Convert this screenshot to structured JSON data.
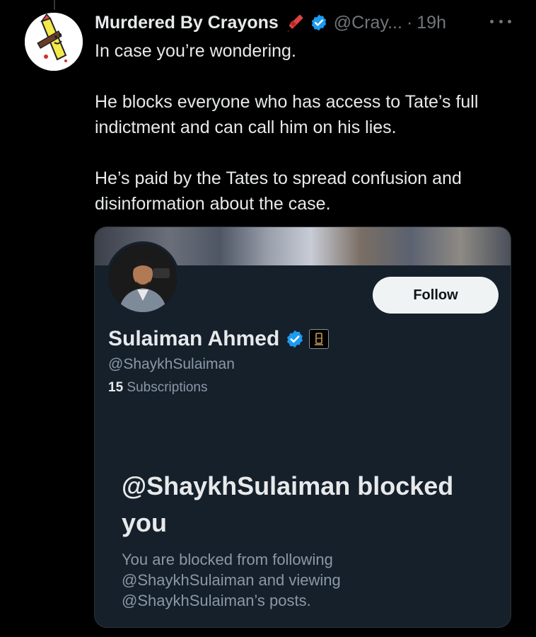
{
  "tweet": {
    "author_name": "Murdered By Crayons",
    "author_handle": "@Cray...",
    "separator": "·",
    "time": "19h",
    "text": [
      "In case you’re wondering.",
      "He blocks everyone who has access to Tate’s full indictment and can call him on his lies.",
      "He’s paid by the Tates to spread confusion and disinformation about the case."
    ]
  },
  "profile_card": {
    "name": "Sulaiman Ahmed",
    "handle": "@ShaykhSulaiman",
    "subscriptions_count": "15",
    "subscriptions_label": "Subscriptions",
    "follow_label": "Follow",
    "blocked_title": "@ShaykhSulaiman blocked you",
    "blocked_desc": "You are blocked from following @ShaykhSulaiman and viewing @ShaykhSulaiman’s posts."
  },
  "colors": {
    "background": "#000000",
    "card_background": "#15202b",
    "verified_blue": "#1d9bf0",
    "muted_text": "#71767b"
  },
  "icons": [
    "crayon-icon",
    "verified-icon",
    "more-icon",
    "affiliate-badge-icon"
  ]
}
